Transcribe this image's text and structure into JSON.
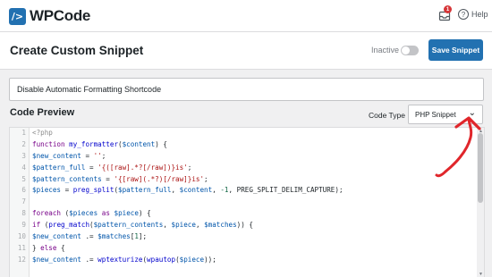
{
  "app": {
    "name": "WPCode"
  },
  "topbar": {
    "notification_count": "1",
    "help_label": "Help"
  },
  "header": {
    "title": "Create Custom Snippet",
    "status_label": "Inactive",
    "active": false,
    "save_label": "Save Snippet"
  },
  "snippet": {
    "title_value": "Disable Automatic Formatting Shortcode"
  },
  "code_preview": {
    "heading": "Code Preview",
    "code_type_label": "Code Type",
    "code_type_value": "PHP Snippet",
    "lines": [
      "<?php",
      "function my_formatter($content) {",
      "$new_content = '';",
      "$pattern_full = '{([raw].*?[/raw])}is';",
      "$pattern_contents = '{[raw](.*?)[/raw]}is';",
      "$pieces = preg_split($pattern_full, $content, -1, PREG_SPLIT_DELIM_CAPTURE);",
      "",
      "foreach ($pieces as $piece) {",
      "if (preg_match($pattern_contents, $piece, $matches)) {",
      "$new_content .= $matches[1];",
      "} else {",
      "$new_content .= wptexturize(wpautop($piece));"
    ]
  },
  "colors": {
    "accent": "#2271b1",
    "badge": "#d63638",
    "annotation": "#e0262b"
  },
  "icons": {
    "logo": "wpcode-logo-icon",
    "notifications": "inbox-icon",
    "help": "help-icon",
    "caret": "chevron-down-icon"
  }
}
